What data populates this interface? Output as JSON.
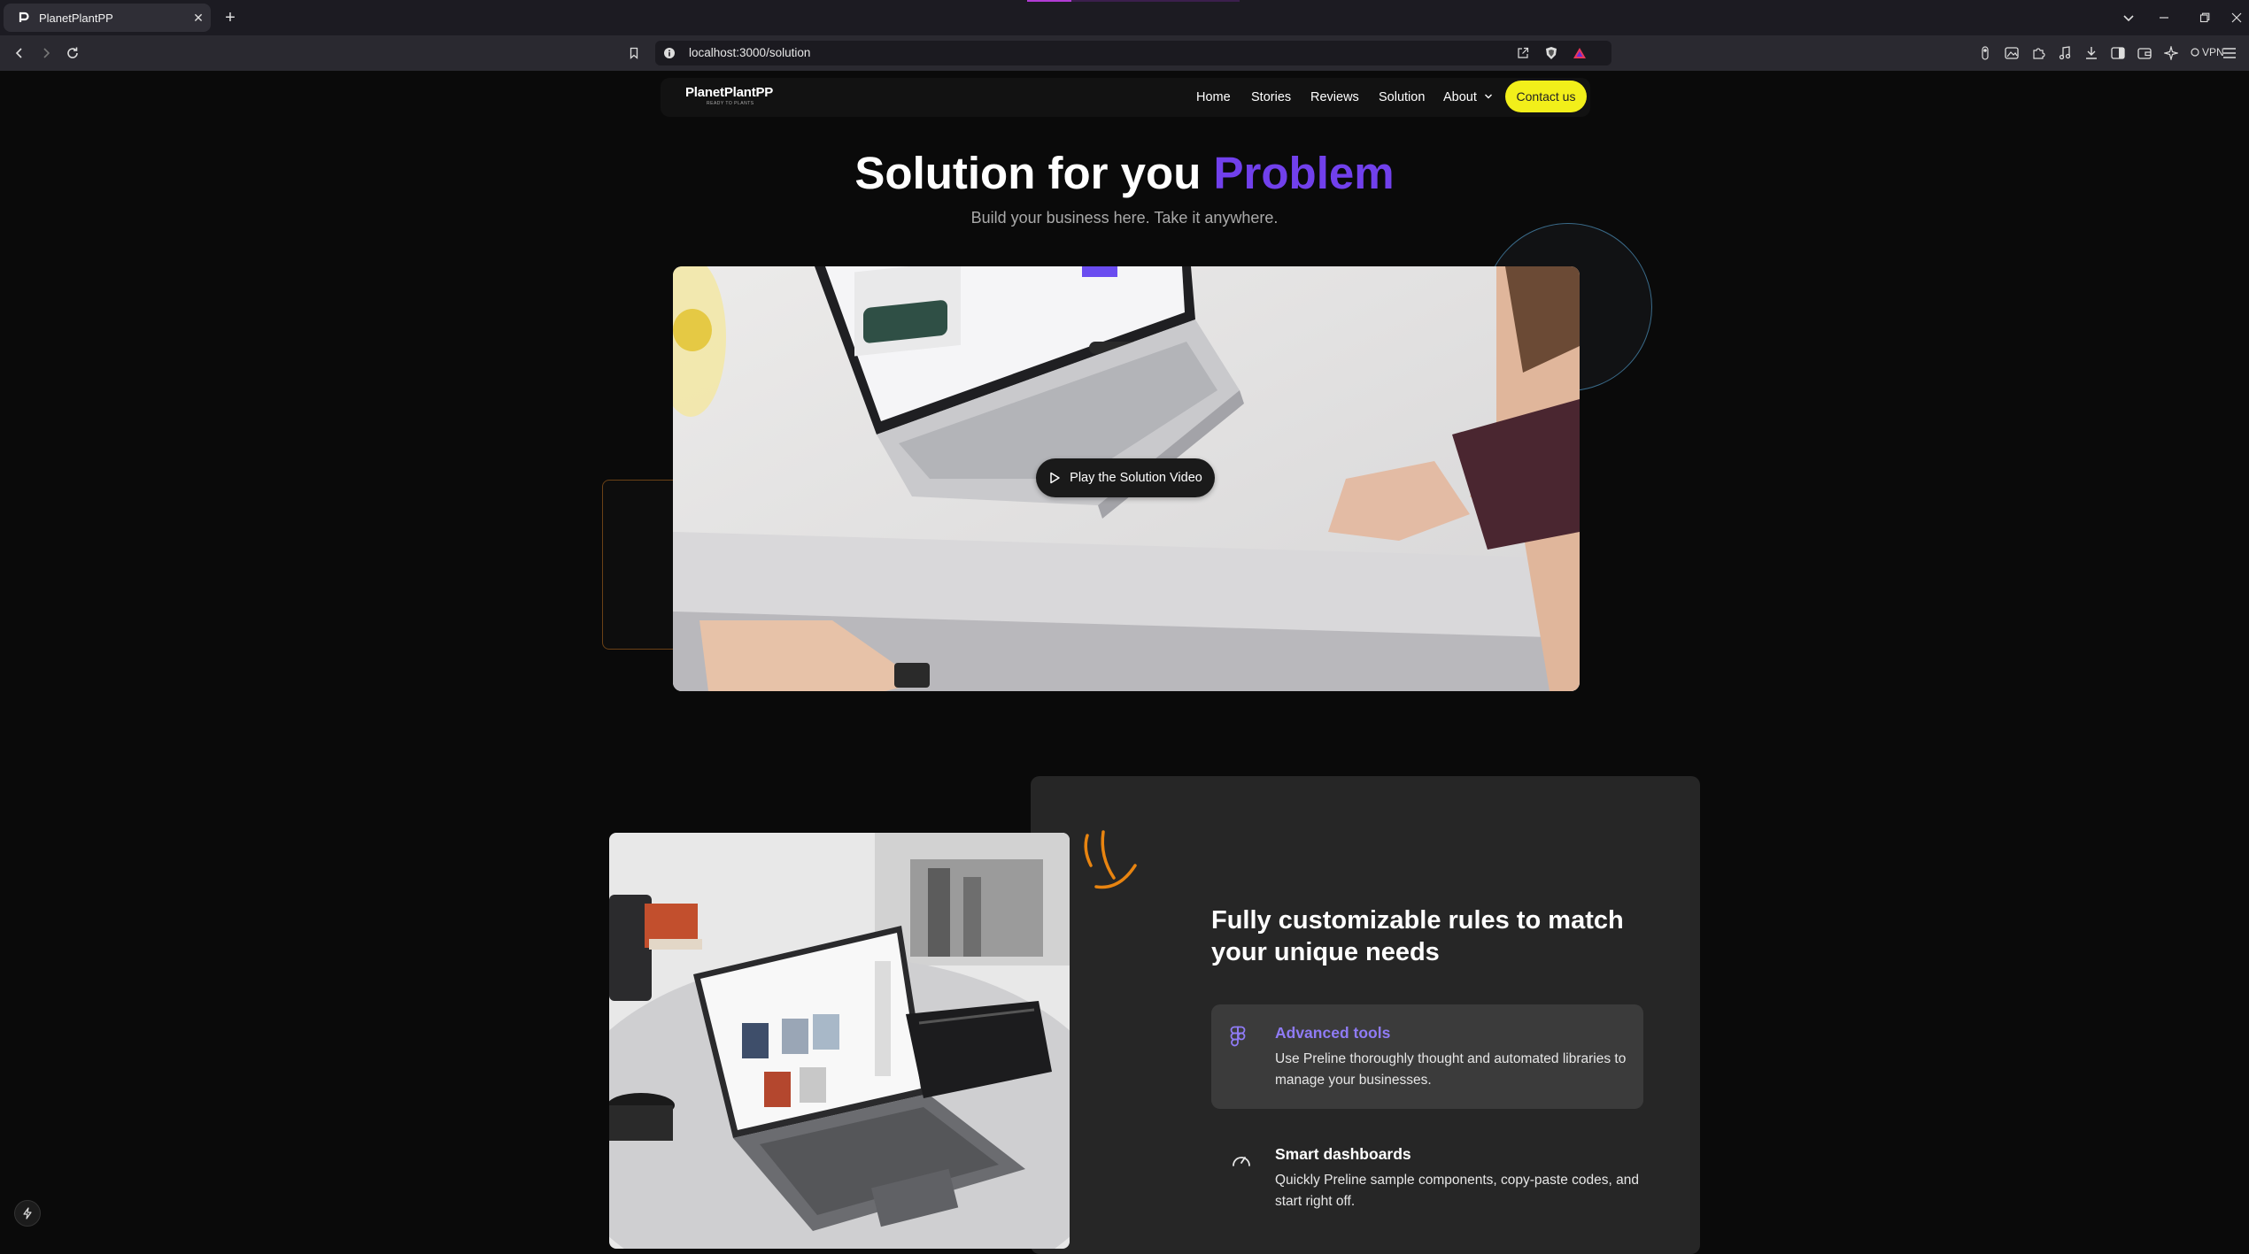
{
  "browser": {
    "tab_title": "PlanetPlantPP",
    "tab_close": "✕",
    "new_tab": "+",
    "url": "localhost:3000/solution",
    "vpn_label": "VPN"
  },
  "site": {
    "logo_text": "PlanetPlantPP",
    "logo_tagline": "READY TO PLANTS",
    "nav": [
      "Home",
      "Stories",
      "Reviews",
      "Solution",
      "About"
    ],
    "contact_label": "Contact us"
  },
  "hero": {
    "title_main": "Solution for you",
    "title_accent": "Problem",
    "subtitle": "Build your business here. Take it anywhere.",
    "play_label": "Play the Solution Video"
  },
  "features": {
    "title": "Fully customizable rules to match your unique needs",
    "items": [
      {
        "title": "Advanced tools",
        "desc": "Use Preline thoroughly thought and automated libraries to manage your businesses.",
        "icon": "figma-icon",
        "active": true
      },
      {
        "title": "Smart dashboards",
        "desc": "Quickly Preline sample components, copy-paste codes, and start right off.",
        "icon": "gauge-icon",
        "active": false
      }
    ]
  },
  "colors": {
    "accent_purple": "#7140ec",
    "contact_yellow": "#f2ef1a",
    "active_feature_title": "#8f7bf5",
    "orange_squiggle": "#e88410"
  }
}
